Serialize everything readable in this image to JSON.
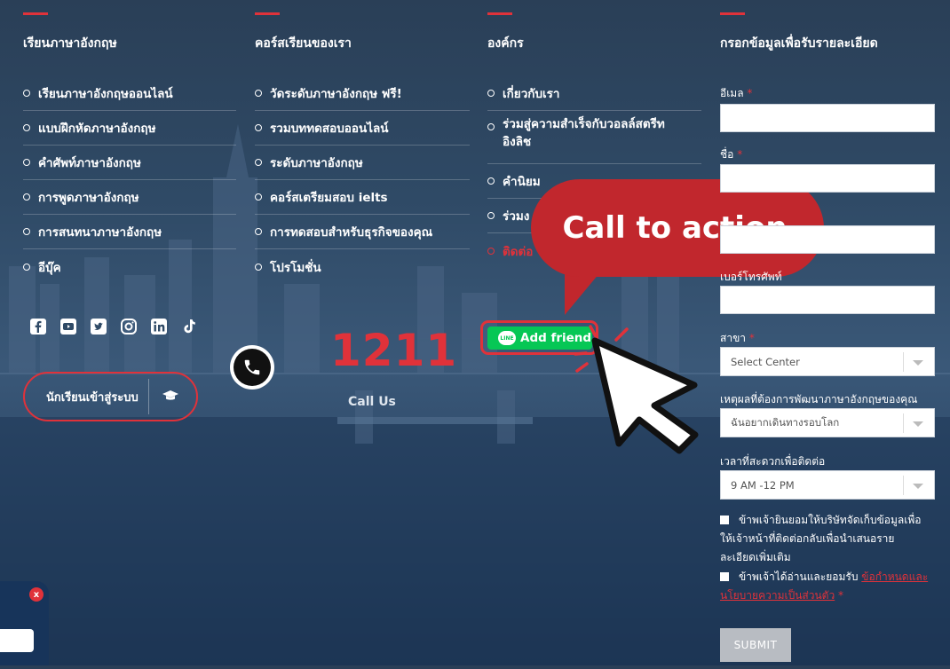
{
  "footer": {
    "col1": {
      "title": "เรียนภาษาอังกฤษ",
      "links": [
        "เรียนภาษาอังกฤษออนไลน์",
        "แบบฝึกหัดภาษาอังกฤษ",
        "คำศัพท์ภาษาอังกฤษ",
        "การพูดภาษาอังกฤษ",
        "การสนทนาภาษาอังกฤษ",
        "อีบุ๊ค"
      ]
    },
    "col2": {
      "title": "คอร์สเรียนของเรา",
      "links": [
        "วัดระดับภาษาอังกฤษ ฟรี!",
        "รวมบททดสอบออนไลน์",
        "ระดับภาษาอังกฤษ",
        "คอร์สเตรียมสอบ ielts",
        "การทดสอบสำหรับธุรกิจของคุณ",
        "โปรโมชั่น"
      ]
    },
    "col3": {
      "title": "องค์กร",
      "links": [
        "เกี่ยวกับเรา",
        "ร่วมสู่ความสำเร็จกับวอลล์สตรีท",
        "อิงลิช",
        "คำนิยม",
        "ร่วมง",
        "ติดต่อ"
      ]
    },
    "col4": {
      "title": "กรอกข้อมูลเพื่อรับรายละเอียด"
    }
  },
  "social_icons": [
    "facebook-icon",
    "youtube-icon",
    "twitter-icon",
    "instagram-icon",
    "linkedin-icon",
    "tiktok-icon"
  ],
  "login": {
    "label": "นักเรียนเข้าสู่ระบบ"
  },
  "hotline": {
    "number": "1211",
    "label": "Call Us"
  },
  "line_button": {
    "logo": "LINE",
    "label": "Add friend"
  },
  "callout": {
    "text": "Call to action"
  },
  "form": {
    "email_label": "อีเมล",
    "name_label": "ชื่อ",
    "phone_label": "เบอร์โทรศัพท์",
    "branch_label": "สาขา",
    "branch_value": "Select Center",
    "reason_label": "เหตุผลที่ต้องการพัฒนาภาษาอังกฤษของคุณ",
    "reason_value": "ฉันอยากเดินทางรอบโลก",
    "time_label": "เวลาที่สะดวกเพื่อติดต่อ",
    "time_value": "9 AM -12 PM",
    "consent1": "ข้าพเจ้ายินยอมให้บริษัทจัดเก็บข้อมูลเพื่อให้เจ้าหน้าที่ติดต่อกลับเพื่อนำเสนอรายละเอียดเพิ่มเติม",
    "consent2_prefix": "ข้าพเจ้าได้อ่านและยอมรับ",
    "consent2_link": "ข้อกำหนดและนโยบายความเป็นส่วนตัว",
    "submit": "SUBMIT",
    "required_mark": "*"
  },
  "chat": {
    "close": "x"
  },
  "colors": {
    "accent": "#e0323a",
    "line_green": "#06c755",
    "callout_red": "#c1272d"
  }
}
